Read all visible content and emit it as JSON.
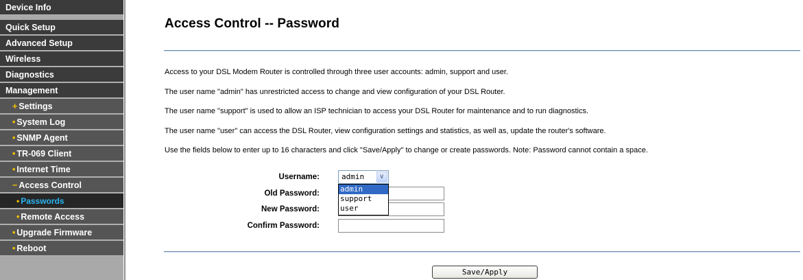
{
  "sidebar": {
    "items": [
      {
        "label": "Device Info"
      },
      {
        "label": "Quick Setup"
      },
      {
        "label": "Advanced Setup"
      },
      {
        "label": "Wireless"
      },
      {
        "label": "Diagnostics"
      },
      {
        "label": "Management"
      },
      {
        "bullet": "+",
        "label": "Settings"
      },
      {
        "bullet": "•",
        "label": "System Log"
      },
      {
        "bullet": "•",
        "label": "SNMP Agent"
      },
      {
        "bullet": "•",
        "label": "TR-069 Client"
      },
      {
        "bullet": "•",
        "label": "Internet Time"
      },
      {
        "bullet": "−",
        "label": "Access Control"
      },
      {
        "bullet": "•",
        "label": "Passwords"
      },
      {
        "bullet": "•",
        "label": "Remote Access"
      },
      {
        "bullet": "•",
        "label": "Upgrade Firmware"
      },
      {
        "bullet": "•",
        "label": "Reboot"
      }
    ]
  },
  "page": {
    "title": "Access Control -- Password",
    "paragraphs": [
      "Access to your DSL Modem Router is controlled through three user accounts: admin, support and user.",
      "The user name \"admin\" has unrestricted access to change and view configuration of your DSL Router.",
      "The user name \"support\" is used to allow an ISP technician to access your DSL Router for maintenance and to run diagnostics.",
      "The user name \"user\" can access the DSL Router, view configuration settings and statistics, as well as, update the router's software.",
      "Use the fields below to enter up to 16 characters and click \"Save/Apply\" to change or create passwords. Note: Password cannot contain a space."
    ]
  },
  "form": {
    "username_label": "Username:",
    "username_value": "admin",
    "username_options": [
      "admin",
      "support",
      "user"
    ],
    "old_password_label": "Old Password:",
    "new_password_label": "New Password:",
    "confirm_password_label": "Confirm Password:",
    "old_password_value": "",
    "new_password_value": "",
    "confirm_password_value": "",
    "save_label": "Save/Apply"
  },
  "colors": {
    "sidebar_item_bg": "#3b3b3b",
    "sidebar_sub_bg": "#555555",
    "sidebar_active_text": "#29b4f0",
    "bullet": "#f2c200",
    "divider": "#6b8bab",
    "selected_option_bg": "#316ac5"
  }
}
